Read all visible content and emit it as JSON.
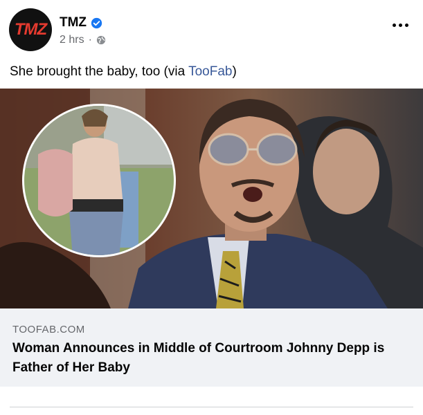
{
  "header": {
    "avatar_text": "TMZ",
    "page_name": "TMZ",
    "time": "2 hrs",
    "separator": "·",
    "verified_icon": "verified-badge-icon",
    "audience_icon": "globe-icon",
    "more_icon": "more-options-icon"
  },
  "post": {
    "text_before": "She brought the baby, too (via ",
    "link_text": "TooFab",
    "text_after": ")"
  },
  "link_preview": {
    "domain": "TOOFAB.COM",
    "title": "Woman Announces in Middle of Courtroom Johnny Depp is Father of Her Baby"
  },
  "colors": {
    "brand_red": "#e53a2f",
    "link_blue": "#385898",
    "verified_blue": "#1877f2",
    "preview_bg": "#f0f2f5"
  }
}
